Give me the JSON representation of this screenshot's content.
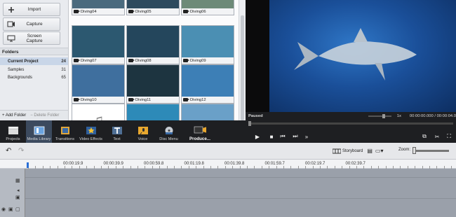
{
  "left_panel": {
    "buttons": [
      {
        "label": "Import",
        "icon": "plus-icon"
      },
      {
        "label": "Capture",
        "icon": "camera-icon"
      },
      {
        "label": "Screen Capture",
        "icon": "monitor-icon"
      }
    ],
    "folders_title": "Folders",
    "folders": [
      {
        "name": "Current Project",
        "count": "24",
        "selected": true
      },
      {
        "name": "Samples",
        "count": "31",
        "selected": false
      },
      {
        "name": "Backgrounds",
        "count": "65",
        "selected": false
      }
    ],
    "add_folder": "+ Add Folder",
    "delete_folder": "− Delete Folder"
  },
  "media_grid": {
    "items": [
      {
        "label": "Diving04",
        "color": "#4a6a7e"
      },
      {
        "label": "Diving05",
        "color": "#2d4a5e"
      },
      {
        "label": "Diving06",
        "color": "#6d8a78"
      },
      {
        "label": "Diving07",
        "color": "#2c5870"
      },
      {
        "label": "Diving08",
        "color": "#24465c"
      },
      {
        "label": "Diving09",
        "color": "#4b8fb3"
      },
      {
        "label": "Diving10",
        "color": "#3f6f9e"
      },
      {
        "label": "Diving11",
        "color": "#1d3440"
      },
      {
        "label": "Diving12",
        "color": "#3d7fb6"
      },
      {
        "label": "",
        "color": "#ffffff"
      },
      {
        "label": "",
        "color": "#2d8ab8"
      },
      {
        "label": "",
        "color": "#6aa0c8"
      }
    ]
  },
  "preview": {
    "status": "Paused",
    "speed": "1x",
    "timecode": "00:00:00.000 / 00:00:04.0"
  },
  "toolbar": {
    "items": [
      {
        "label": "Projects",
        "icon": "clapper-icon",
        "active": false
      },
      {
        "label": "Media Library",
        "icon": "media-library-icon",
        "active": true
      },
      {
        "label": "Transitions",
        "icon": "film-transition-icon",
        "active": false
      },
      {
        "label": "Video Effects",
        "icon": "star-effect-icon",
        "active": false
      },
      {
        "label": "Text",
        "icon": "text-t-icon",
        "active": false
      },
      {
        "label": "Voice",
        "icon": "microphone-icon",
        "active": false
      },
      {
        "label": "Disc Menu",
        "icon": "disc-icon",
        "active": false
      }
    ],
    "produce_label": "Produce..."
  },
  "timeline": {
    "storyboard_label": "Storyboard",
    "zoom_label": "Zoom:",
    "ruler": [
      "00:00:19.9",
      "00:00:39.9",
      "00:00:59.8",
      "00:01:19.8",
      "00:01:39.8",
      "00:01:59.7",
      "00:02:19.7",
      "00:02:39.7"
    ]
  }
}
